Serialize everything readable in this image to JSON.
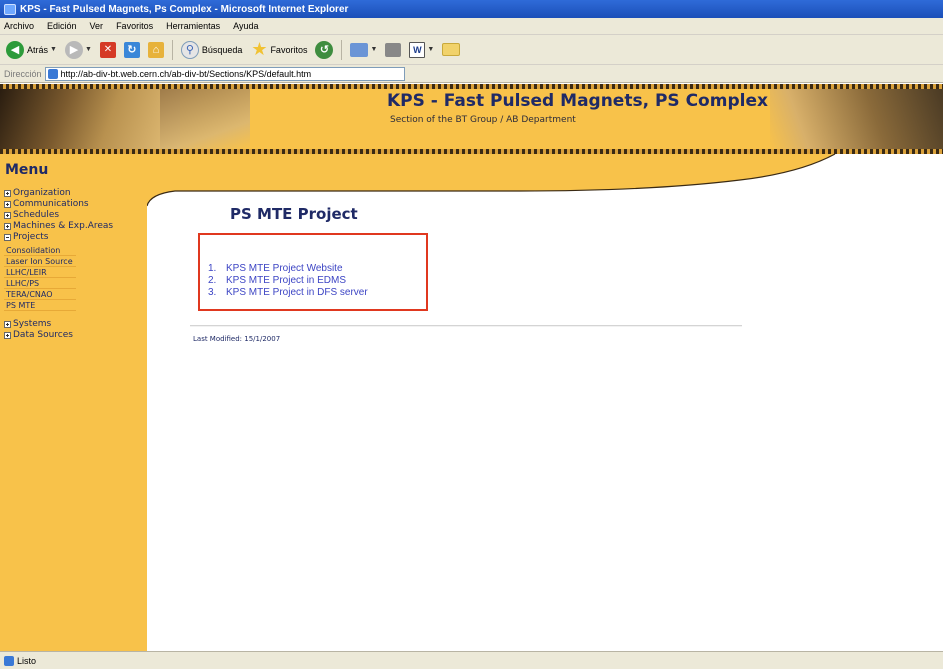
{
  "window": {
    "title": "KPS - Fast Pulsed Magnets, Ps Complex - Microsoft Internet Explorer"
  },
  "menubar": {
    "items": [
      "Archivo",
      "Edición",
      "Ver",
      "Favoritos",
      "Herramientas",
      "Ayuda"
    ]
  },
  "toolbar": {
    "back_label": "Atrás",
    "search_label": "Búsqueda",
    "favorites_label": "Favoritos"
  },
  "addressbar": {
    "label": "Dirección",
    "url": "http://ab-div-bt.web.cern.ch/ab-div-bt/Sections/KPS/default.htm"
  },
  "banner": {
    "title": "KPS - Fast Pulsed Magnets, PS Complex",
    "subtitle": "Section of the BT Group / AB Department"
  },
  "sidebar": {
    "heading": "Menu",
    "items": [
      "Organization",
      "Communications",
      "Schedules",
      "Machines & Exp.Areas",
      "Projects"
    ],
    "project_subitems": [
      "Consolidation",
      "Laser Ion Source",
      "LLHC/LEIR",
      "LLHC/PS",
      "TERA/CNAO",
      "PS MTE"
    ],
    "items_after": [
      "Systems",
      "Data Sources"
    ]
  },
  "content": {
    "heading": "PS MTE Project",
    "links": [
      {
        "num": "1.",
        "label": "KPS MTE Project Website"
      },
      {
        "num": "2.",
        "label": "KPS MTE Project in EDMS"
      },
      {
        "num": "3.",
        "label": "KPS MTE Project in DFS server"
      }
    ],
    "last_modified": "Last Modified: 15/1/2007"
  },
  "statusbar": {
    "text": "Listo"
  },
  "colors": {
    "banner": "#f8c24a",
    "heading_blue": "#1f2a66",
    "link_blue": "#3c44c4",
    "highlight_red": "#e0381f",
    "title_bar": "#2f6bd8"
  }
}
